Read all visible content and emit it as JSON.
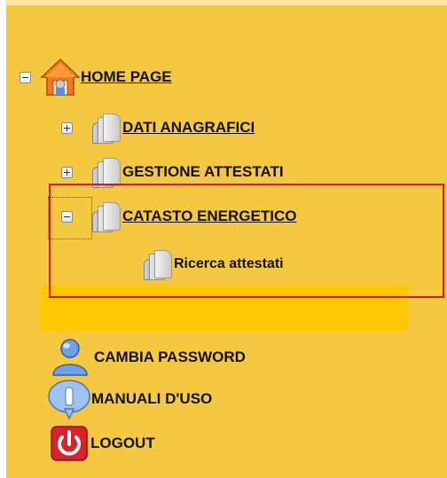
{
  "menu": {
    "home": {
      "label": "HOME PAGE",
      "icon": "home-icon"
    },
    "items": [
      {
        "label": "DATI ANAGRAFICI",
        "icon": "book-icon",
        "toggle": "expand"
      },
      {
        "label": "GESTIONE ATTESTATI",
        "icon": "book-icon",
        "toggle": "expand"
      },
      {
        "label": "CATASTO ENERGETICO",
        "icon": "book-icon",
        "toggle": "collapse"
      }
    ],
    "subitem": {
      "label": "Ricerca attestati",
      "icon": "book-icon"
    },
    "bottom": [
      {
        "label": "CAMBIA PASSWORD",
        "icon": "user-icon"
      },
      {
        "label": "MANUALI D'USO",
        "icon": "info-icon"
      },
      {
        "label": "LOGOUT",
        "icon": "power-icon"
      }
    ]
  },
  "colors": {
    "panel_bg": "#f5c842",
    "strip": "#ffc800",
    "highlight": "#e0141c"
  }
}
